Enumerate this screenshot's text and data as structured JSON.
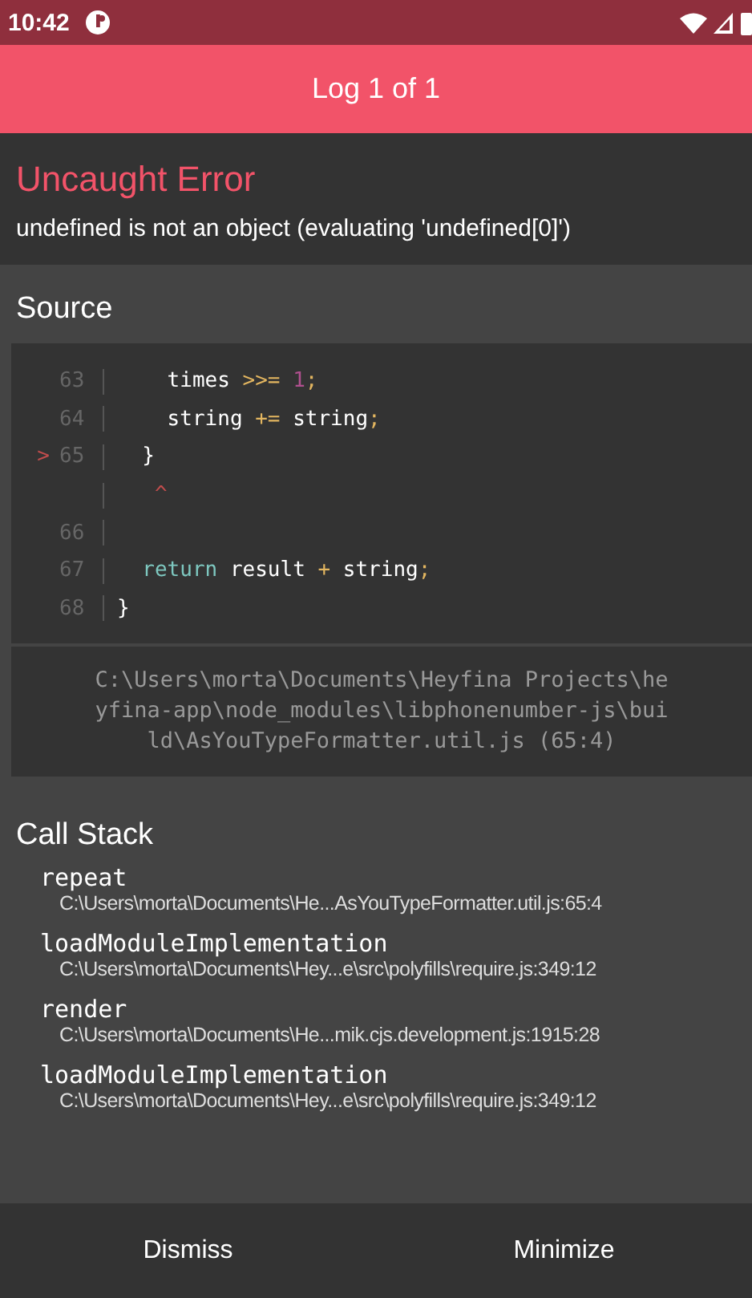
{
  "status_bar": {
    "time": "10:42"
  },
  "header": {
    "title": "Log 1 of 1"
  },
  "error": {
    "title": "Uncaught Error",
    "message": "undefined is not an object (evaluating 'undefined[0]')"
  },
  "source": {
    "heading": "Source",
    "lines": [
      {
        "number": "63",
        "tokens": [
          {
            "kind": "plain",
            "text": "    times "
          },
          {
            "kind": "op",
            "text": ">>="
          },
          {
            "kind": "num",
            "text": " 1"
          },
          {
            "kind": "op",
            "text": ";"
          }
        ]
      },
      {
        "number": "64",
        "tokens": [
          {
            "kind": "plain",
            "text": "    string "
          },
          {
            "kind": "op",
            "text": "+="
          },
          {
            "kind": "plain",
            "text": " string"
          },
          {
            "kind": "op",
            "text": ";"
          }
        ]
      },
      {
        "number": "65",
        "marker": ">",
        "tokens": [
          {
            "kind": "plain",
            "text": "  }"
          }
        ]
      },
      {
        "tokens": [
          {
            "kind": "caret",
            "text": "   ^"
          }
        ]
      },
      {
        "number": "66"
      },
      {
        "number": "67",
        "tokens": [
          {
            "kind": "keyword",
            "text": "  return"
          },
          {
            "kind": "plain",
            "text": " result "
          },
          {
            "kind": "op",
            "text": "+"
          },
          {
            "kind": "plain",
            "text": " string"
          },
          {
            "kind": "op",
            "text": ";"
          }
        ]
      },
      {
        "number": "68",
        "tokens": [
          {
            "kind": "plain",
            "text": "}"
          }
        ]
      }
    ],
    "file": "C:\\Users\\morta\\Documents\\Heyfina Projects\\heyfina-app\\node_modules\\libphonenumber-js\\build\\AsYouTypeFormatter.util.js (65:4)"
  },
  "call_stack": {
    "heading": "Call Stack",
    "frames": [
      {
        "function": "repeat",
        "location": "C:\\Users\\morta\\Documents\\He...AsYouTypeFormatter.util.js:65:4"
      },
      {
        "function": "loadModuleImplementation",
        "location": "C:\\Users\\morta\\Documents\\Hey...e\\src\\polyfills\\require.js:349:12"
      },
      {
        "function": "render",
        "location": "C:\\Users\\morta\\Documents\\He...mik.cjs.development.js:1915:28"
      },
      {
        "function": "loadModuleImplementation",
        "location": "C:\\Users\\morta\\Documents\\Hey...e\\src\\polyfills\\require.js:349:12"
      }
    ]
  },
  "buttons": [
    "Dismiss",
    "Minimize"
  ]
}
